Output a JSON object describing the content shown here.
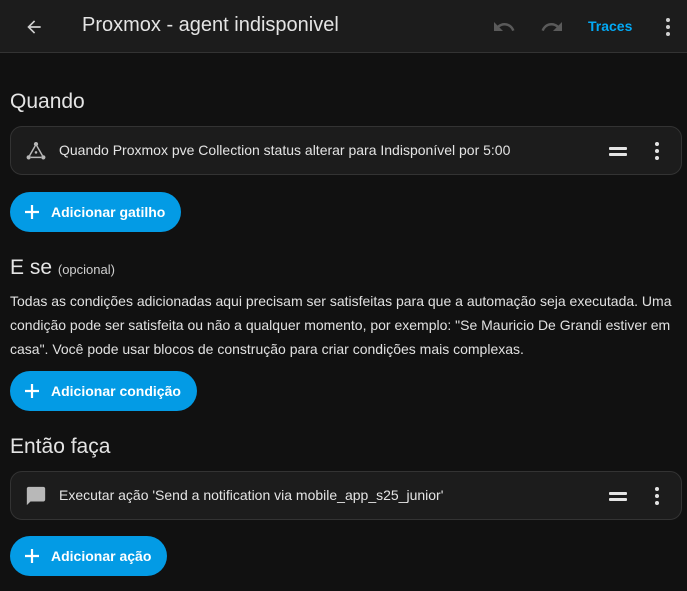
{
  "header": {
    "title": "Proxmox - agent indisponivel",
    "traces_label": "Traces",
    "back_icon": "arrow-left-icon",
    "undo_icon": "undo-icon",
    "redo_icon": "redo-icon",
    "menu_icon": "dots-vertical-icon"
  },
  "triggers": {
    "heading": "Quando",
    "items": [
      {
        "icon": "state-trigger-icon",
        "text": "Quando Proxmox pve Collection status alterar para Indisponível por 5:00"
      }
    ],
    "add_label": "Adicionar gatilho"
  },
  "conditions": {
    "heading": "E se",
    "optional": "(opcional)",
    "description": "Todas as condições adicionadas aqui precisam ser satisfeitas para que a automação seja executada. Uma condição pode ser satisfeita ou não a qualquer momento, por exemplo: \"Se Mauricio De Grandi estiver em casa\". Você pode usar blocos de construção para criar condições mais complexas.",
    "add_label": "Adicionar condição"
  },
  "actions": {
    "heading": "Então faça",
    "items": [
      {
        "icon": "message-icon",
        "text": "Executar ação 'Send a notification via mobile_app_s25_junior'"
      }
    ],
    "add_label": "Adicionar ação"
  },
  "colors": {
    "accent": "#03a9f4",
    "button_bg": "#039be5",
    "background": "#111111",
    "card_bg": "#1c1c1c"
  }
}
